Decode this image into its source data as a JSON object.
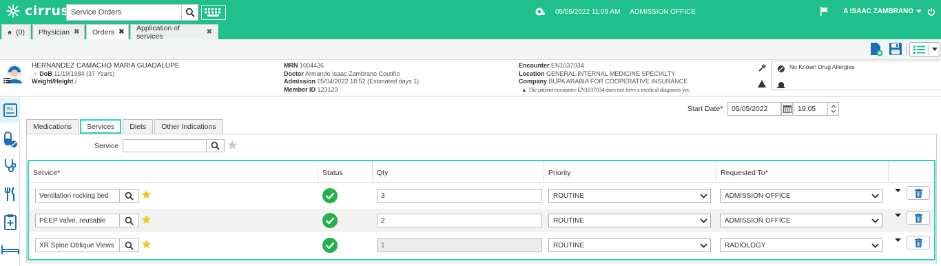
{
  "app": {
    "name": "cirrus"
  },
  "search": {
    "value": "Service Orders"
  },
  "status": {
    "datetime": "05/05/2022 11:09 AM",
    "location": "ADMISSION OFFICE"
  },
  "user": {
    "name": "A ISAAC ZAMBRANO"
  },
  "window_tabs": [
    {
      "label": "(0)",
      "icon": "home-icon"
    },
    {
      "label": "Physician"
    },
    {
      "label": "Orders",
      "active": true
    },
    {
      "label": "Application of services"
    }
  ],
  "patient": {
    "name": "HERNANDEZ CAMACHO MARIA GUADALUPE",
    "dob_label": "DoB",
    "dob_value": "11/19/1984 (37 Years)",
    "wh_label": "Weight/Height",
    "wh_value": "/",
    "mrn_label": "MRN",
    "mrn_value": "1004426",
    "doctor_label": "Doctor",
    "doctor_value": "Armando Isaac Zambrano Coutiño",
    "admission_label": "Admission",
    "admission_value": "05/04/2022 18:52 (Estimated days 1)",
    "member_label": "Member ID",
    "member_value": "123123",
    "encounter_label": "Encounter",
    "encounter_value": "EN1037034",
    "location_label": "Location",
    "location_value": "GENERAL INTERNAL MEDICINE SPECIALTY",
    "company_label": "Company",
    "company_value": "BUPA ARABIA FOR COOPERATIVE INSURANCE",
    "warning": "The patient encounter EN1037034 does not have a medical diagnosis yet.",
    "allergies": "No Known Drug Allergies"
  },
  "start": {
    "label": "Start Date*",
    "date": "05/05/2022",
    "time": "19:05"
  },
  "subtabs": [
    "Medications",
    "Services",
    "Diets",
    "Other Indications"
  ],
  "service_filter": {
    "label": "Service",
    "value": ""
  },
  "table": {
    "headers": [
      "Service*",
      "Status",
      "Qty",
      "Priority",
      "Requested To*",
      ""
    ],
    "rows": [
      {
        "service": "Ventilation rocking bed",
        "qty": "3",
        "priority": "ROUTINE",
        "requested_to": "ADMISSION OFFICE",
        "qty_disabled": false
      },
      {
        "service": "PEEP valve, reusable",
        "qty": "2",
        "priority": "ROUTINE",
        "requested_to": "ADMISSION OFFICE",
        "qty_disabled": false
      },
      {
        "service": "XR Spine Oblique Views",
        "qty": "1",
        "priority": "ROUTINE",
        "requested_to": "RADIOLOGY",
        "qty_disabled": true
      }
    ]
  },
  "colors": {
    "brand": "#1fc08c",
    "highlight": "#2fd1bd",
    "star": "#f5c518",
    "status_ok": "#22b14c",
    "icon_blue": "#1c6fb5"
  }
}
